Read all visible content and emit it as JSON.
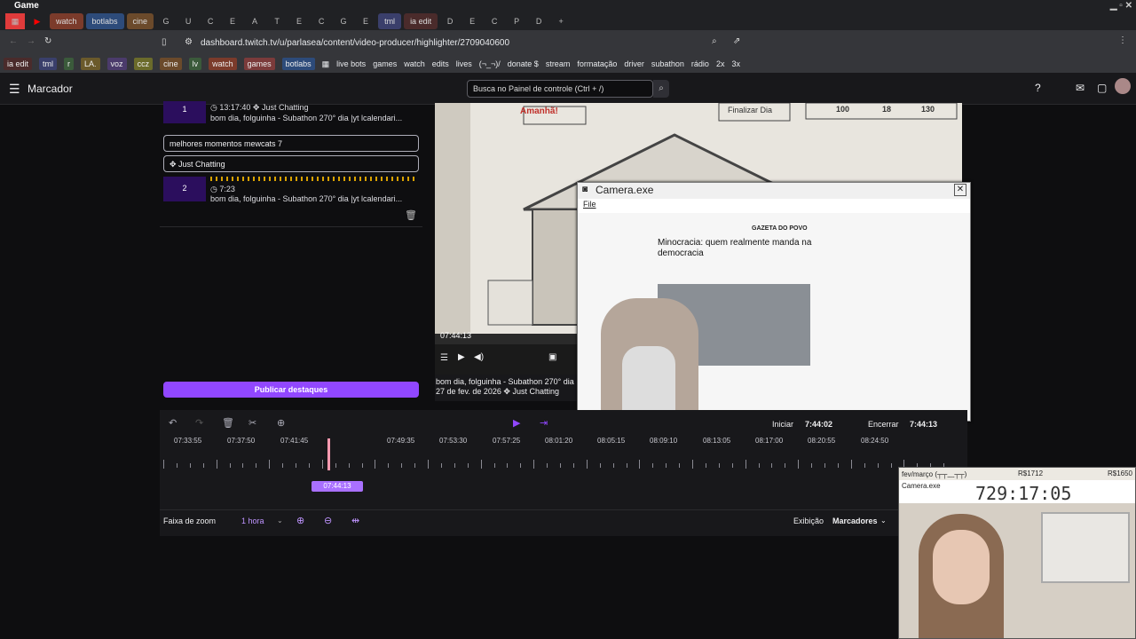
{
  "window": {
    "title": "Game"
  },
  "tabs": {
    "chips": [
      "watch",
      "botlabs",
      "cine",
      "tml",
      "ia edit"
    ],
    "icon_tabs": [
      "G",
      "U",
      "C",
      "E",
      "A",
      "T",
      "E",
      "C",
      "G",
      "E",
      "D",
      "E",
      "C",
      "P",
      "D"
    ]
  },
  "address": {
    "url": "dashboard.twitch.tv/u/parlasea/content/video-producer/highlighter/2709040600"
  },
  "bookmarks": {
    "chips": [
      "ia edit",
      "tml",
      "r",
      "LA.",
      "voz",
      "ccz",
      "cine",
      "lv",
      "watch",
      "games",
      "botlabs"
    ],
    "folders": [
      "live bots",
      "games",
      "watch",
      "edits",
      "lives",
      "(¬_¬)/",
      "donate $",
      "stream",
      "formatação",
      "driver",
      "subathon",
      "rádio",
      "2x",
      "3x"
    ]
  },
  "header": {
    "title": "Marcador",
    "search_placeholder": "Busca no Painel de controle (Ctrl + /)",
    "menu_icon": "hamburger-icon"
  },
  "highlights": [
    {
      "num": "1",
      "time": "13:17:40",
      "category": "Just Chatting",
      "title": "bom dia, folguinha - Subathon 270° dia |yt lcalendari..."
    },
    {
      "num": "2",
      "time": "7:23",
      "category": "",
      "title": "bom dia, folguinha - Subathon 270° dia |yt lcalendari..."
    }
  ],
  "editor": {
    "title_value": "melhores momentos mewcats 7",
    "category_value": "Just Chatting",
    "publish_label": "Publicar destaques"
  },
  "video": {
    "timestamp": "07:44:13",
    "game_labels": {
      "amanha": "Amanhã!",
      "finalizar": "Finalizar Dia",
      "score1": "100",
      "score2": "18",
      "score3": "130"
    },
    "caption_title": "bom dia, folguinha - Subathon 270° dia",
    "caption_date": "27 de fev. de 2026",
    "caption_category": "Just Chatting"
  },
  "camera": {
    "title": "Camera.exe",
    "menu_file": "File",
    "article_brand": "GAZETA DO POVO",
    "article_headline_1": "Minocracia: quem realmente manda na",
    "article_headline_2": "democracia"
  },
  "timeline": {
    "start_label": "Iniciar",
    "start_value": "7:44:02",
    "end_label": "Encerrar",
    "end_value": "7:44:13",
    "playhead": "07:44:13",
    "ticks": [
      "07:33:55",
      "07:37:50",
      "07:41:45",
      "07:49:35",
      "07:53:30",
      "07:57:25",
      "08:01:20",
      "08:05:15",
      "08:09:10",
      "08:13:05",
      "08:17:00",
      "08:20:55",
      "08:24:50"
    ],
    "zoom_label": "Faixa de zoom",
    "zoom_value": "1 hora",
    "view_label": "Exibição",
    "view_value": "Marcadores"
  },
  "smallcam": {
    "header_left": "fev/março (┬┬﹏┬┬)",
    "header_mid": "R$1712",
    "header_right": "R$1650",
    "window_title": "Camera.exe",
    "counter": "729:17:05"
  }
}
